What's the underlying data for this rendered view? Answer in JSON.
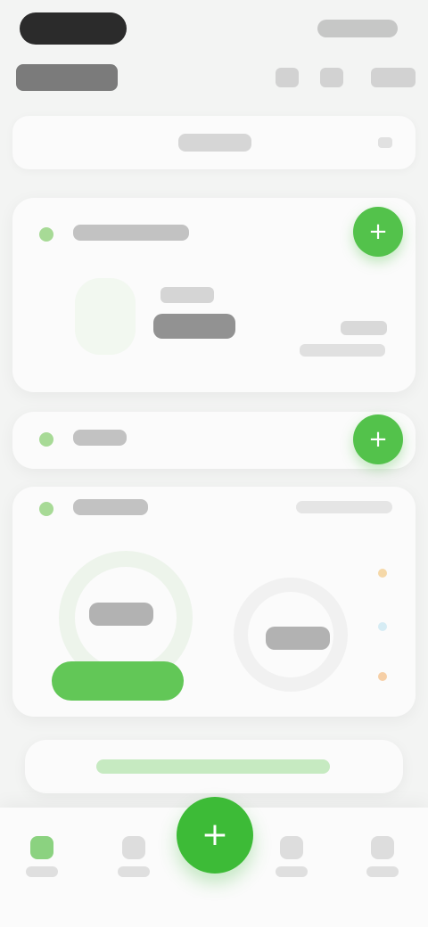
{
  "status_bar": {
    "time": "",
    "indicators": ""
  },
  "header": {
    "title": "",
    "actions": {
      "calendar_icon": "calendar-icon",
      "share_icon": "share-icon",
      "more_icon": "more-icon"
    }
  },
  "date_bar": {
    "date_text": "",
    "chevron_icon": "chevron-down-icon"
  },
  "cards": {
    "first": {
      "title": "",
      "primary_value": "",
      "secondary_text": "",
      "right_value": "",
      "right_subtext": "",
      "fab_icon": "plus-icon"
    },
    "second": {
      "title": "",
      "fab_icon": "plus-icon"
    },
    "third": {
      "title": "",
      "right_action": "",
      "ring_values": [
        "",
        ""
      ],
      "legend": [
        "",
        "",
        ""
      ],
      "cta_label": ""
    }
  },
  "banner": {
    "text": ""
  },
  "nav": {
    "items": [
      {
        "icon": "home-icon",
        "label": ""
      },
      {
        "icon": "chart-icon",
        "label": ""
      },
      {
        "icon": "plus-icon",
        "label": ""
      },
      {
        "icon": "book-icon",
        "label": ""
      },
      {
        "icon": "profile-icon",
        "label": ""
      }
    ]
  },
  "colors": {
    "accent_green": "#53c24b",
    "bg": "#f3f4f3",
    "card": "#fbfbfb"
  }
}
